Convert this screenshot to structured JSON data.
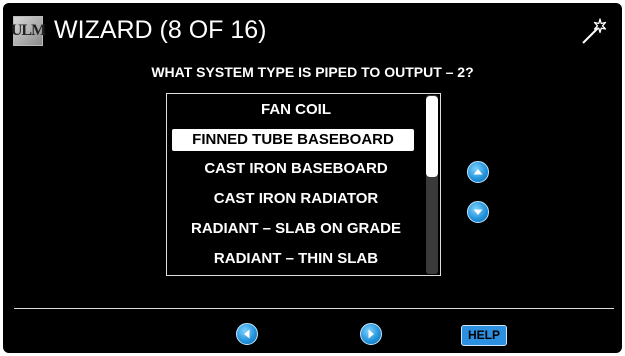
{
  "header": {
    "logo_text": "ULM",
    "title": "WIZARD (8 OF 16)",
    "wand_icon": "magic-wand-icon"
  },
  "question": "WHAT SYSTEM TYPE IS PIPED TO OUTPUT – 2?",
  "options": [
    {
      "label": "FAN COIL",
      "selected": false
    },
    {
      "label": "FINNED TUBE BASEBOARD",
      "selected": true
    },
    {
      "label": "CAST IRON BASEBOARD",
      "selected": false
    },
    {
      "label": "CAST IRON RADIATOR",
      "selected": false
    },
    {
      "label": "RADIANT – SLAB ON GRADE",
      "selected": false
    },
    {
      "label": "RADIANT – THIN SLAB",
      "selected": false
    }
  ],
  "scroll": {
    "up_icon": "chevron-up-icon",
    "down_icon": "chevron-down-icon"
  },
  "footer": {
    "back_icon": "chevron-left-icon",
    "next_icon": "chevron-right-icon",
    "help_label": "HELP"
  },
  "colors": {
    "background": "#000000",
    "accent": "#2c8fe0",
    "text": "#ffffff"
  }
}
